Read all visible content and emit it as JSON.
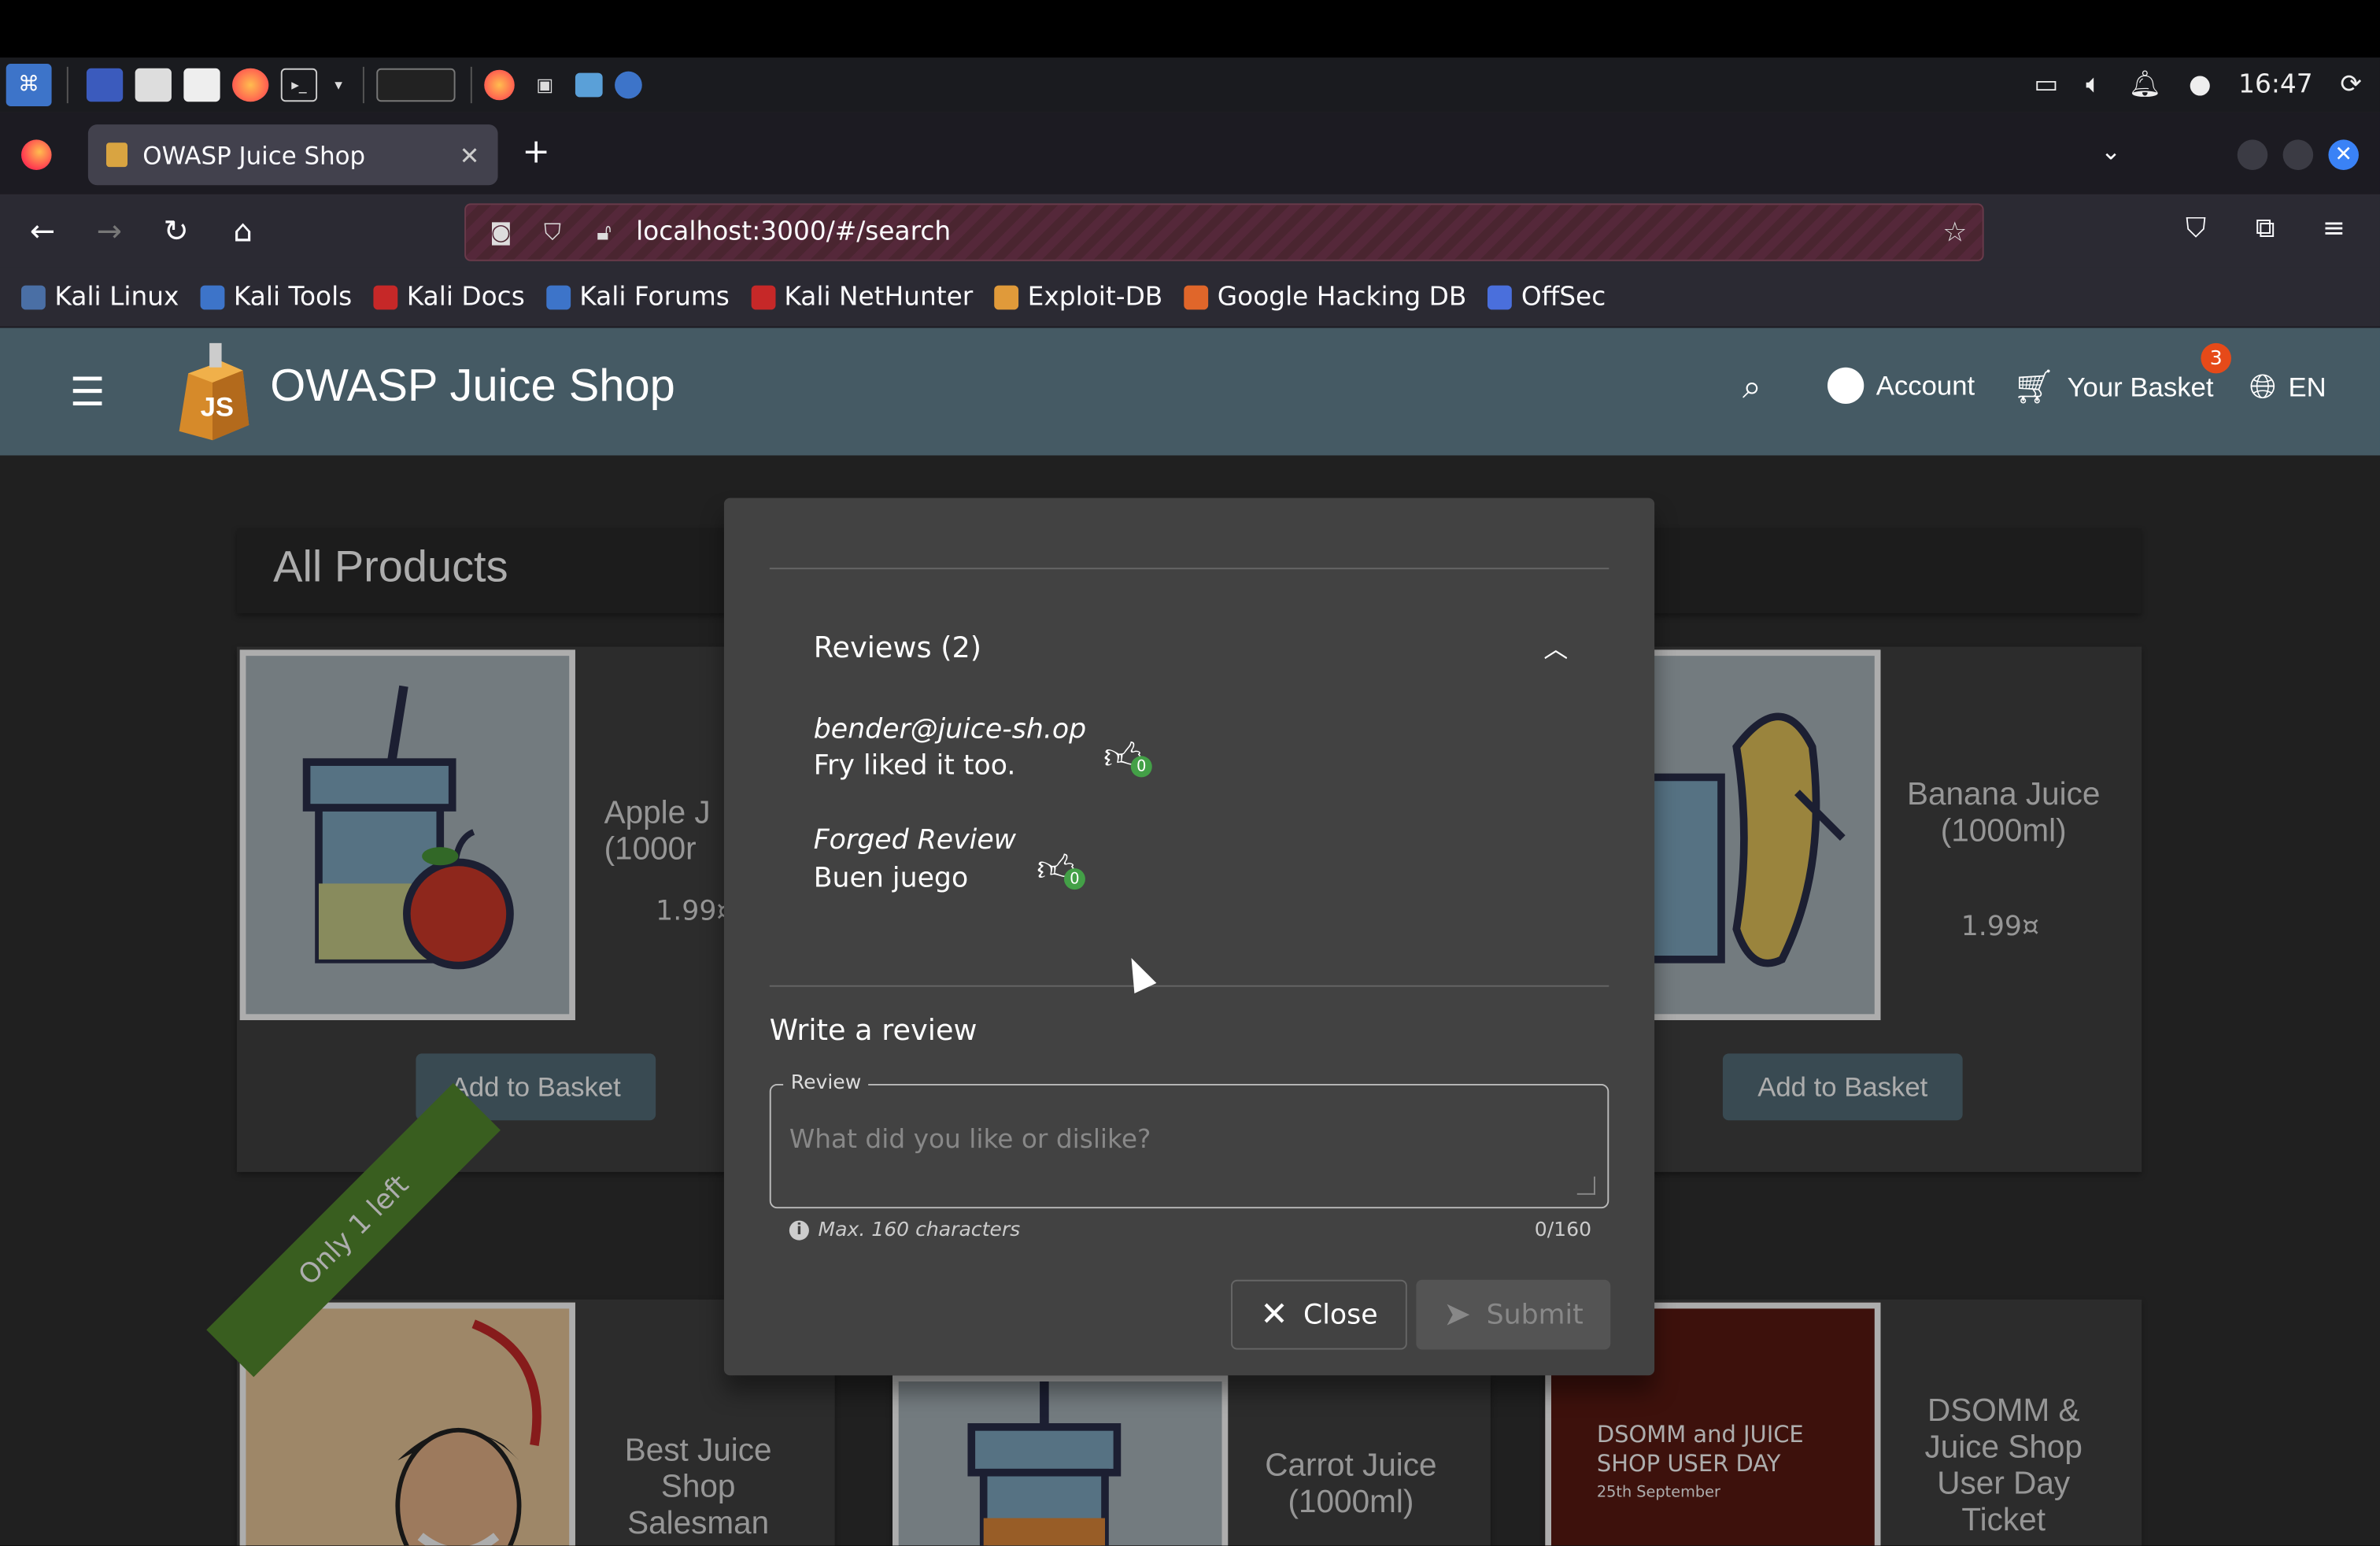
{
  "system_panel": {
    "clock": "16:47",
    "icons": [
      "kali-menu-icon",
      "workspace-icon",
      "files-icon",
      "text-editor-icon",
      "firefox-icon",
      "terminal-icon",
      "screen-icon",
      "volume-icon",
      "bell-icon",
      "user-icon",
      "power-icon"
    ]
  },
  "browser": {
    "tab_title": "OWASP Juice Shop",
    "url": "localhost:3000/#/search",
    "bookmarks": [
      {
        "label": "Kali Linux",
        "color": "#4a6fa5"
      },
      {
        "label": "Kali Tools",
        "color": "#3d74c9"
      },
      {
        "label": "Kali Docs",
        "color": "#c62828"
      },
      {
        "label": "Kali Forums",
        "color": "#3d74c9"
      },
      {
        "label": "Kali NetHunter",
        "color": "#c62828"
      },
      {
        "label": "Exploit-DB",
        "color": "#e09a3a"
      },
      {
        "label": "Google Hacking DB",
        "color": "#e0662a"
      },
      {
        "label": "OffSec",
        "color": "#4a6fdc"
      }
    ]
  },
  "app": {
    "title": "OWASP Juice Shop",
    "account_label": "Account",
    "basket_label": "Your Basket",
    "basket_count": "3",
    "language": "EN"
  },
  "main": {
    "heading": "All Products",
    "add_to_basket": "Add to Basket",
    "products": [
      {
        "name": "Apple J\n(1000r",
        "price": "1.99¤"
      },
      {
        "name": "Banana Juice (1000ml)",
        "price": "1.99¤"
      },
      {
        "name": "Best Juice Shop Salesman",
        "ribbon": "Only 1 left"
      },
      {
        "name": "Carrot Juice (1000ml)"
      },
      {
        "name": "DSOMM & Juice Shop User Day Ticket",
        "poster_title": "DSOMM and JUICE SHOP USER DAY",
        "poster_date": "25th September"
      }
    ]
  },
  "dialog": {
    "reviews_header": "Reviews (2)",
    "reviews": [
      {
        "author": "bender@juice-sh.op",
        "text": "Fry liked it too.",
        "likes": "0"
      },
      {
        "author": "Forged Review",
        "text": "Buen juego",
        "likes": "0"
      }
    ],
    "write_heading": "Write a review",
    "review_label": "Review",
    "review_placeholder": "What did you like or dislike?",
    "hint": "Max. 160 characters",
    "counter": "0/160",
    "close_label": "Close",
    "submit_label": "Submit"
  }
}
